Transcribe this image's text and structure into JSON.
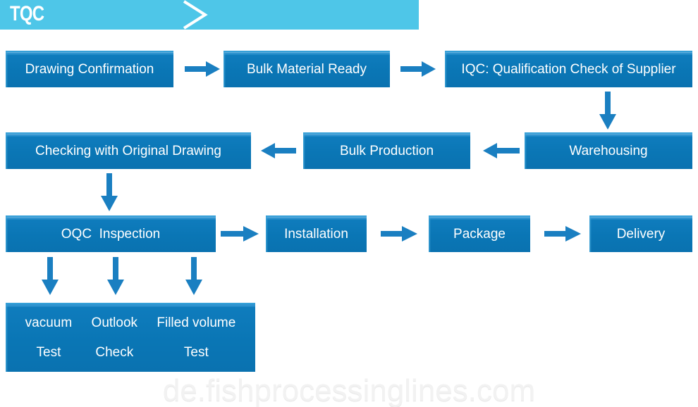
{
  "header": {
    "title": "TQC",
    "chevron_icon": "chevron-right-icon",
    "background": "#4ec6e8"
  },
  "theme": {
    "box_fill": "#0b78b8",
    "box_highlight": "#35a0d8",
    "arrow_color": "#1a7fc1",
    "text_color": "#ffffff",
    "page_background": "#ffffff"
  },
  "flow": {
    "rows": [
      {
        "direction": "left-to-right",
        "steps": [
          {
            "label": "Drawing Confirmation"
          },
          {
            "label": "Bulk Material Ready"
          },
          {
            "label": "IQC: Qualification Check of Supplier"
          }
        ]
      },
      {
        "direction": "right-to-left",
        "steps": [
          {
            "label": "Checking with Original Drawing"
          },
          {
            "label": "Bulk Production"
          },
          {
            "label": "Warehousing"
          }
        ]
      },
      {
        "direction": "left-to-right",
        "steps": [
          {
            "label": "OQC  Inspection"
          },
          {
            "label": "Installation"
          },
          {
            "label": "Package"
          },
          {
            "label": "Delivery"
          }
        ]
      }
    ],
    "tests": {
      "columns": [
        {
          "line1": "vacuum",
          "line2": "Test"
        },
        {
          "line1": "Outlook",
          "line2": "Check"
        },
        {
          "line1": "Filled volume",
          "line2": "Test"
        }
      ]
    },
    "connectors": [
      {
        "name": "arrow-drawing-to-bulk-material",
        "icon": "arrow-right-icon"
      },
      {
        "name": "arrow-bulk-material-to-iqc",
        "icon": "arrow-right-icon"
      },
      {
        "name": "arrow-iqc-to-warehousing",
        "icon": "arrow-down-icon"
      },
      {
        "name": "arrow-warehousing-to-bulk-production",
        "icon": "arrow-left-icon"
      },
      {
        "name": "arrow-bulk-production-to-checking",
        "icon": "arrow-left-icon"
      },
      {
        "name": "arrow-checking-to-oqc",
        "icon": "arrow-down-icon"
      },
      {
        "name": "arrow-oqc-to-installation",
        "icon": "arrow-right-icon"
      },
      {
        "name": "arrow-installation-to-package",
        "icon": "arrow-right-icon"
      },
      {
        "name": "arrow-package-to-delivery",
        "icon": "arrow-right-icon"
      },
      {
        "name": "arrow-oqc-to-vacuum-test",
        "icon": "arrow-down-icon"
      },
      {
        "name": "arrow-oqc-to-outlook-check",
        "icon": "arrow-down-icon"
      },
      {
        "name": "arrow-oqc-to-filled-volume-test",
        "icon": "arrow-down-icon"
      }
    ]
  },
  "watermark": {
    "text": "de.fishprocessinglines.com"
  }
}
